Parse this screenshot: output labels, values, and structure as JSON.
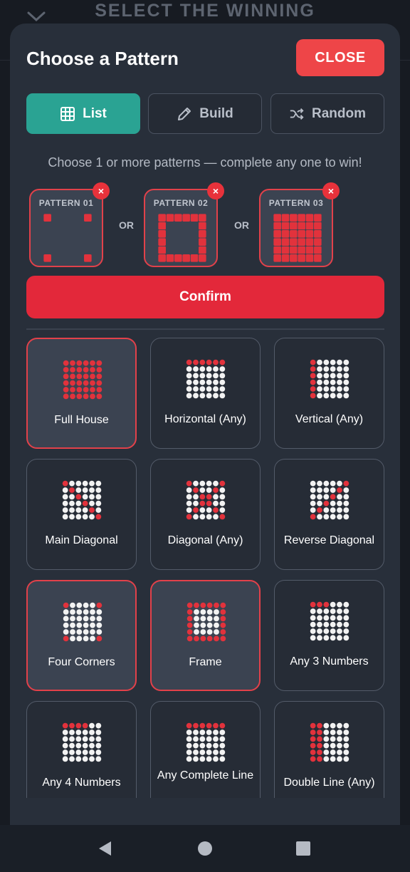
{
  "background": {
    "title": "SELECT THE WINNING"
  },
  "modal": {
    "title": "Choose a Pattern",
    "close_label": "CLOSE",
    "tabs": [
      {
        "label": "List",
        "icon": "grid-icon",
        "active": true
      },
      {
        "label": "Build",
        "icon": "pencil-icon",
        "active": false
      },
      {
        "label": "Random",
        "icon": "shuffle-icon",
        "active": false
      }
    ],
    "hint": "Choose 1 or more patterns — complete any one to win!",
    "selected": [
      {
        "label": "PATTERN 01",
        "pattern": "four_corners"
      },
      {
        "label": "PATTERN 02",
        "pattern": "frame"
      },
      {
        "label": "PATTERN 03",
        "pattern": "full_house"
      }
    ],
    "or_label": "OR",
    "remove_symbol": "×",
    "confirm_label": "Confirm",
    "patterns": [
      {
        "name": "Full House",
        "key": "full_house",
        "selected": true
      },
      {
        "name": "Horizontal (Any)",
        "key": "horizontal",
        "selected": false
      },
      {
        "name": "Vertical (Any)",
        "key": "vertical",
        "selected": false
      },
      {
        "name": "Main Diagonal",
        "key": "main_diagonal",
        "selected": false
      },
      {
        "name": "Diagonal (Any)",
        "key": "diagonal_any",
        "selected": false
      },
      {
        "name": "Reverse Diagonal",
        "key": "reverse_diagonal",
        "selected": false
      },
      {
        "name": "Four Corners",
        "key": "four_corners",
        "selected": true
      },
      {
        "name": "Frame",
        "key": "frame",
        "selected": true
      },
      {
        "name": "Any 3 Numbers",
        "key": "any3",
        "selected": false
      },
      {
        "name": "Any 4 Numbers",
        "key": "any4",
        "selected": false
      },
      {
        "name": "Any Complete Line",
        "key": "any_line",
        "selected": false
      },
      {
        "name": "Double Line (Any)",
        "key": "double_line",
        "selected": false
      }
    ]
  },
  "colors": {
    "accent_red": "#e3283a",
    "accent_teal": "#2aa393",
    "dot_white": "#f2f2f2",
    "dot_red": "#e2323c"
  },
  "nav": [
    {
      "icon": "back-icon"
    },
    {
      "icon": "home-icon"
    },
    {
      "icon": "recents-icon"
    }
  ]
}
